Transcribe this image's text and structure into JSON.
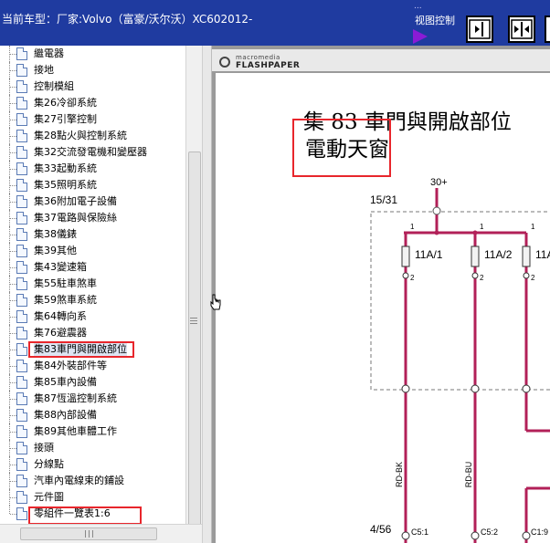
{
  "header": {
    "title": "当前车型：厂家:Volvo（富豪/沃尔沃）XC602012-",
    "view_control_label": "视图控制",
    "top_underline": "...",
    "buttons": [
      {
        "name": "fit-width-button"
      },
      {
        "name": "fit-page-button"
      },
      {
        "name": "next-button"
      }
    ]
  },
  "tree": {
    "items": [
      {
        "label": "繼電器"
      },
      {
        "label": "接地"
      },
      {
        "label": "控制模組"
      },
      {
        "label": "集26冷卻系統"
      },
      {
        "label": "集27引擎控制"
      },
      {
        "label": "集28點火與控制系統"
      },
      {
        "label": "集32交流發電機和變壓器"
      },
      {
        "label": "集33起動系統"
      },
      {
        "label": "集35照明系統"
      },
      {
        "label": "集36附加電子設備"
      },
      {
        "label": "集37電路與保險絲"
      },
      {
        "label": "集38儀錶"
      },
      {
        "label": "集39其他"
      },
      {
        "label": "集43變速箱"
      },
      {
        "label": "集55駐車煞車"
      },
      {
        "label": "集59煞車系統"
      },
      {
        "label": "集64轉向系"
      },
      {
        "label": "集76避震器"
      },
      {
        "label": "集83車門與開啟部位"
      },
      {
        "label": "集84外裝部件等"
      },
      {
        "label": "集85車內設備"
      },
      {
        "label": "集87恆溫控制系統"
      },
      {
        "label": "集88內部設備"
      },
      {
        "label": "集89其他車體工作"
      },
      {
        "label": "接頭"
      },
      {
        "label": "分線點"
      },
      {
        "label": "汽車內電線束的鋪設"
      },
      {
        "label": "元件圖"
      },
      {
        "label": "零組件一覽表1:6"
      }
    ],
    "selected_index": 18,
    "highlighted_indices": [
      18,
      28
    ]
  },
  "viewer": {
    "logo_small": "macromedia",
    "logo_big": "FLASHPAPER",
    "doc_title_line1": "集 83 車門與開啟部位",
    "doc_title_line2": "電動天窗",
    "schematic": {
      "label_30": "30+",
      "label_15_31": "15/31",
      "label_4_56": "4/56",
      "fuses": [
        "11A/1",
        "11A/2",
        "11A"
      ],
      "pin_1": "1",
      "pin_2": "2",
      "wires": [
        "RD-BK",
        "RD-BU"
      ],
      "connectors": [
        "C5:1",
        "C5:2",
        "C1:9"
      ]
    }
  },
  "colors": {
    "header_bg": "#1f3ba0",
    "arrow": "#8a1bd6",
    "highlight_box": "#e8262c",
    "wire": "#b22058"
  }
}
